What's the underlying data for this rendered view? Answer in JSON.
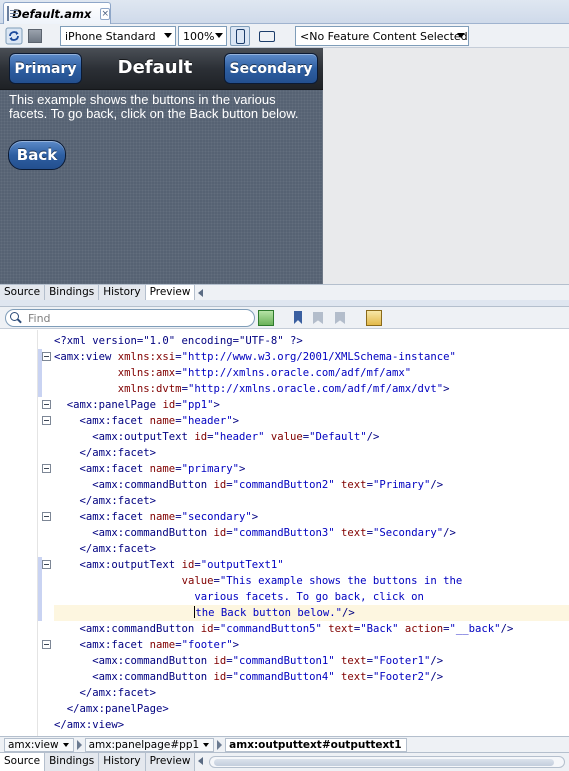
{
  "document_tab": {
    "title": "Default.amx",
    "close": "×"
  },
  "toolbar": {
    "device": "iPhone Standard",
    "zoom": "100%",
    "feature": "<No Feature Content Selected>"
  },
  "preview": {
    "primary_label": "Primary",
    "title": "Default",
    "secondary_label": "Secondary",
    "output_text": "This example shows the buttons in the various facets. To go back, click on the Back button below.",
    "back_label": "Back"
  },
  "view_tabs": [
    "Source",
    "Bindings",
    "History",
    "Preview"
  ],
  "active_tab_top": "Preview",
  "active_tab_bottom": "Source",
  "find": {
    "placeholder": "Find"
  },
  "code_lines": [
    [
      [
        "pi",
        "<?xml version=\"1.0\" encoding=\"UTF-8\" ?>"
      ]
    ],
    [
      [
        "tg",
        "<amx:view "
      ],
      [
        "at",
        "xmlns:xsi"
      ],
      [
        "tx",
        "="
      ],
      [
        "vl",
        "\"http://www.w3.org/2001/XMLSchema-instance\""
      ]
    ],
    [
      [
        "tx",
        "          "
      ],
      [
        "at",
        "xmlns:amx"
      ],
      [
        "tx",
        "="
      ],
      [
        "vl",
        "\"http://xmlns.oracle.com/adf/mf/amx\""
      ]
    ],
    [
      [
        "tx",
        "          "
      ],
      [
        "at",
        "xmlns:dvtm"
      ],
      [
        "tx",
        "="
      ],
      [
        "vl",
        "\"http://xmlns.oracle.com/adf/mf/amx/dvt\""
      ],
      [
        "tg",
        ">"
      ]
    ],
    [
      [
        "tg",
        "  <amx:panelPage "
      ],
      [
        "at",
        "id"
      ],
      [
        "tx",
        "="
      ],
      [
        "vl",
        "\"pp1\""
      ],
      [
        "tg",
        ">"
      ]
    ],
    [
      [
        "tg",
        "    <amx:facet "
      ],
      [
        "at",
        "name"
      ],
      [
        "tx",
        "="
      ],
      [
        "vl",
        "\"header\""
      ],
      [
        "tg",
        ">"
      ]
    ],
    [
      [
        "tg",
        "      <amx:outputText "
      ],
      [
        "at",
        "id"
      ],
      [
        "tx",
        "="
      ],
      [
        "vl",
        "\"header\" "
      ],
      [
        "at",
        "value"
      ],
      [
        "tx",
        "="
      ],
      [
        "vl",
        "\"Default\""
      ],
      [
        "tg",
        "/>"
      ]
    ],
    [
      [
        "tg",
        "    </amx:facet>"
      ]
    ],
    [
      [
        "tg",
        "    <amx:facet "
      ],
      [
        "at",
        "name"
      ],
      [
        "tx",
        "="
      ],
      [
        "vl",
        "\"primary\""
      ],
      [
        "tg",
        ">"
      ]
    ],
    [
      [
        "tg",
        "      <amx:commandButton "
      ],
      [
        "at",
        "id"
      ],
      [
        "tx",
        "="
      ],
      [
        "vl",
        "\"commandButton2\" "
      ],
      [
        "at",
        "text"
      ],
      [
        "tx",
        "="
      ],
      [
        "vl",
        "\"Primary\""
      ],
      [
        "tg",
        "/>"
      ]
    ],
    [
      [
        "tg",
        "    </amx:facet>"
      ]
    ],
    [
      [
        "tg",
        "    <amx:facet "
      ],
      [
        "at",
        "name"
      ],
      [
        "tx",
        "="
      ],
      [
        "vl",
        "\"secondary\""
      ],
      [
        "tg",
        ">"
      ]
    ],
    [
      [
        "tg",
        "      <amx:commandButton "
      ],
      [
        "at",
        "id"
      ],
      [
        "tx",
        "="
      ],
      [
        "vl",
        "\"commandButton3\" "
      ],
      [
        "at",
        "text"
      ],
      [
        "tx",
        "="
      ],
      [
        "vl",
        "\"Secondary\""
      ],
      [
        "tg",
        "/>"
      ]
    ],
    [
      [
        "tg",
        "    </amx:facet>"
      ]
    ],
    [
      [
        "tg",
        "    <amx:outputText "
      ],
      [
        "at",
        "id"
      ],
      [
        "tx",
        "="
      ],
      [
        "vl",
        "\"outputText1\""
      ]
    ],
    [
      [
        "tx",
        "                    "
      ],
      [
        "at",
        "value"
      ],
      [
        "tx",
        "="
      ],
      [
        "vl",
        "\"This example shows the buttons in the"
      ]
    ],
    [
      [
        "vl",
        "                      various facets. To go back, click on"
      ]
    ],
    [
      [
        "vl",
        "                      "
      ],
      [
        "cur",
        ""
      ],
      [
        "vl",
        "the Back button below.\""
      ],
      [
        "tg",
        "/>"
      ]
    ],
    [
      [
        "tg",
        "    <amx:commandButton "
      ],
      [
        "at",
        "id"
      ],
      [
        "tx",
        "="
      ],
      [
        "vl",
        "\"commandButton5\" "
      ],
      [
        "at",
        "text"
      ],
      [
        "tx",
        "="
      ],
      [
        "vl",
        "\"Back\" "
      ],
      [
        "at",
        "action"
      ],
      [
        "tx",
        "="
      ],
      [
        "vl",
        "\"__back\""
      ],
      [
        "tg",
        "/>"
      ]
    ],
    [
      [
        "tg",
        "    <amx:facet "
      ],
      [
        "at",
        "name"
      ],
      [
        "tx",
        "="
      ],
      [
        "vl",
        "\"footer\""
      ],
      [
        "tg",
        ">"
      ]
    ],
    [
      [
        "tg",
        "      <amx:commandButton "
      ],
      [
        "at",
        "id"
      ],
      [
        "tx",
        "="
      ],
      [
        "vl",
        "\"commandButton1\" "
      ],
      [
        "at",
        "text"
      ],
      [
        "tx",
        "="
      ],
      [
        "vl",
        "\"Footer1\""
      ],
      [
        "tg",
        "/>"
      ]
    ],
    [
      [
        "tg",
        "      <amx:commandButton "
      ],
      [
        "at",
        "id"
      ],
      [
        "tx",
        "="
      ],
      [
        "vl",
        "\"commandButton4\" "
      ],
      [
        "at",
        "text"
      ],
      [
        "tx",
        "="
      ],
      [
        "vl",
        "\"Footer2\""
      ],
      [
        "tg",
        "/>"
      ]
    ],
    [
      [
        "tg",
        "    </amx:facet>"
      ]
    ],
    [
      [
        "tg",
        "  </amx:panelPage>"
      ]
    ],
    [
      [
        "tg",
        "</amx:view>"
      ]
    ]
  ],
  "breadcrumb": [
    "amx:view",
    "amx:panelpage#pp1",
    "amx:outputtext#outputtext1"
  ],
  "icons": {
    "refresh": "refresh-icon",
    "stop": "stop-icon",
    "phone": "phone-icon",
    "tablet": "tablet-icon",
    "find": "search-icon",
    "find_results": "find-results-icon",
    "bookmark": "bookmark-icon",
    "tasks": "tasks-icon"
  },
  "colors": {
    "accent_button": "#2e5fa2",
    "device_background": "#566273",
    "xml_tag": "#000080",
    "xml_attribute": "#800000",
    "xml_value": "#0000c0"
  }
}
